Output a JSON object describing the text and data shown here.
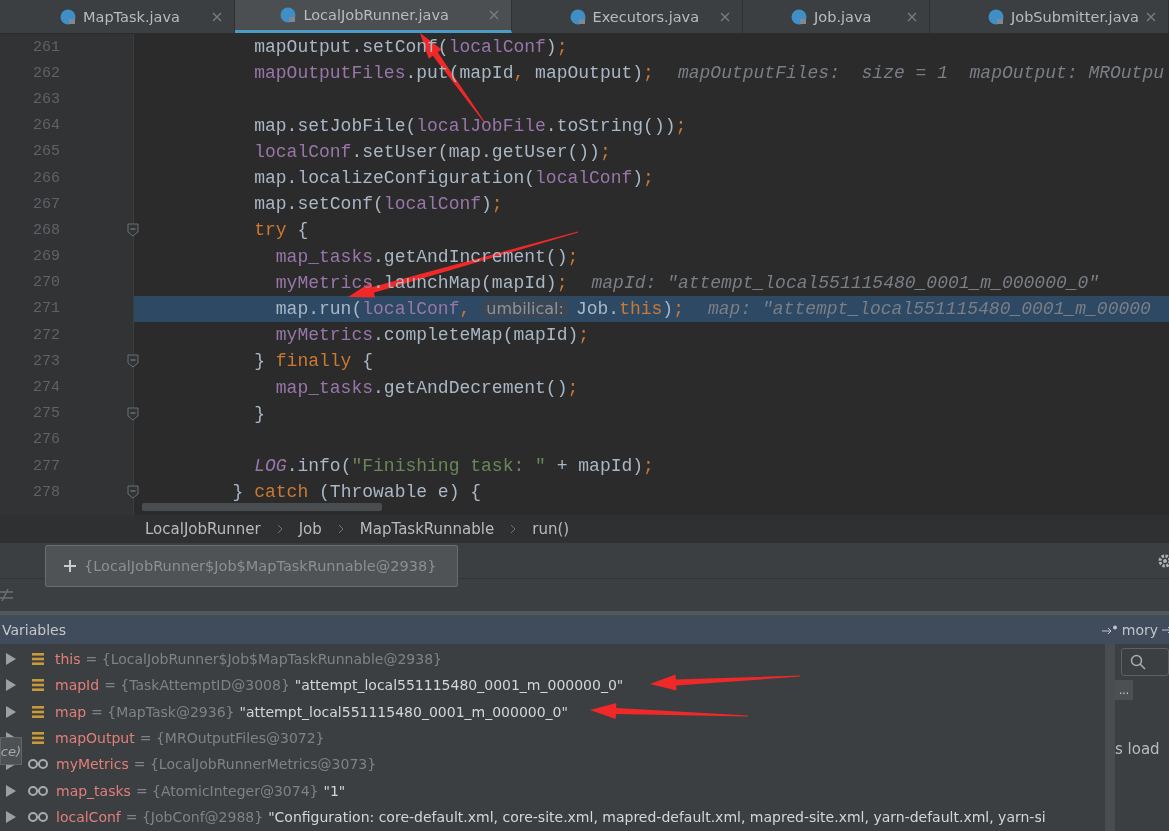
{
  "tabs": [
    {
      "label": "MapTask.java",
      "selected": false
    },
    {
      "label": "LocalJobRunner.java",
      "selected": true
    },
    {
      "label": "Executors.java",
      "selected": false
    },
    {
      "label": "Job.java",
      "selected": false
    },
    {
      "label": "JobSubmitter.java",
      "selected": false
    }
  ],
  "editor": {
    "lines": [
      {
        "number": "261",
        "fold": false,
        "current": false,
        "tokens": [
          {
            "kind": "plain",
            "text": "    mapOutput.setConf("
          },
          {
            "kind": "field",
            "text": "localConf"
          },
          {
            "kind": "plain",
            "text": ")"
          },
          {
            "kind": "keyword",
            "text": ";"
          }
        ]
      },
      {
        "number": "262",
        "fold": false,
        "current": false,
        "tokens": [
          {
            "kind": "field",
            "text": "    mapOutputFiles"
          },
          {
            "kind": "plain",
            "text": ".put(mapId"
          },
          {
            "kind": "keyword",
            "text": ","
          },
          {
            "kind": "plain",
            "text": " mapOutput)"
          },
          {
            "kind": "keyword",
            "text": ";"
          },
          {
            "kind": "hint",
            "text": "mapOutputFiles:  size = 1  mapOutput: MROutpu"
          }
        ]
      },
      {
        "number": "263",
        "fold": false,
        "current": false
      },
      {
        "number": "264",
        "fold": false,
        "current": false,
        "tokens": [
          {
            "kind": "plain",
            "text": "    map.setJobFile("
          },
          {
            "kind": "field",
            "text": "localJobFile"
          },
          {
            "kind": "plain",
            "text": ".toString())"
          },
          {
            "kind": "keyword",
            "text": ";"
          }
        ]
      },
      {
        "number": "265",
        "fold": false,
        "current": false,
        "tokens": [
          {
            "kind": "field",
            "text": "    localConf"
          },
          {
            "kind": "plain",
            "text": ".setUser(map.getUser())"
          },
          {
            "kind": "keyword",
            "text": ";"
          }
        ]
      },
      {
        "number": "266",
        "fold": false,
        "current": false,
        "tokens": [
          {
            "kind": "plain",
            "text": "    map.localizeConfiguration("
          },
          {
            "kind": "field",
            "text": "localConf"
          },
          {
            "kind": "plain",
            "text": ")"
          },
          {
            "kind": "keyword",
            "text": ";"
          }
        ]
      },
      {
        "number": "267",
        "fold": false,
        "current": false,
        "tokens": [
          {
            "kind": "plain",
            "text": "    map.setConf("
          },
          {
            "kind": "field",
            "text": "localConf"
          },
          {
            "kind": "plain",
            "text": ")"
          },
          {
            "kind": "keyword",
            "text": ";"
          }
        ]
      },
      {
        "number": "268",
        "fold": true,
        "current": false,
        "tokens": [
          {
            "kind": "keyword",
            "text": "    try"
          },
          {
            "kind": "plain",
            "text": " {"
          }
        ]
      },
      {
        "number": "269",
        "fold": false,
        "current": false,
        "tokens": [
          {
            "kind": "field",
            "text": "      map_tasks"
          },
          {
            "kind": "plain",
            "text": ".getAndIncrement()"
          },
          {
            "kind": "keyword",
            "text": ";"
          }
        ]
      },
      {
        "number": "270",
        "fold": false,
        "current": false,
        "tokens": [
          {
            "kind": "field",
            "text": "      myMetrics"
          },
          {
            "kind": "plain",
            "text": ".launchMap(mapId)"
          },
          {
            "kind": "keyword",
            "text": ";"
          },
          {
            "kind": "hint",
            "text": "mapId: \"attempt_local551115480_0001_m_000000_0\""
          }
        ]
      },
      {
        "number": "271",
        "fold": false,
        "current": true,
        "tokens": [
          {
            "kind": "plain",
            "text": "      map.run("
          },
          {
            "kind": "field",
            "text": "localConf"
          },
          {
            "kind": "keyword",
            "text": ","
          },
          {
            "kind": "param",
            "text": "umbilical:"
          },
          {
            "kind": "plain",
            "text": "Job."
          },
          {
            "kind": "keyword",
            "text": "this"
          },
          {
            "kind": "plain",
            "text": ")"
          },
          {
            "kind": "keyword",
            "text": ";"
          },
          {
            "kind": "hint",
            "text": "map: \"attempt_local551115480_0001_m_00000"
          }
        ]
      },
      {
        "number": "272",
        "fold": false,
        "current": false,
        "tokens": [
          {
            "kind": "field",
            "text": "      myMetrics"
          },
          {
            "kind": "plain",
            "text": ".completeMap(mapId)"
          },
          {
            "kind": "keyword",
            "text": ";"
          }
        ]
      },
      {
        "number": "273",
        "fold": true,
        "current": false,
        "tokens": [
          {
            "kind": "plain",
            "text": "    } "
          },
          {
            "kind": "keyword",
            "text": "finally"
          },
          {
            "kind": "plain",
            "text": " {"
          }
        ]
      },
      {
        "number": "274",
        "fold": false,
        "current": false,
        "tokens": [
          {
            "kind": "field",
            "text": "      map_tasks"
          },
          {
            "kind": "plain",
            "text": ".getAndDecrement()"
          },
          {
            "kind": "keyword",
            "text": ";"
          }
        ]
      },
      {
        "number": "275",
        "fold": true,
        "current": false,
        "tokens": [
          {
            "kind": "plain",
            "text": "    }"
          }
        ]
      },
      {
        "number": "276",
        "fold": false,
        "current": false
      },
      {
        "number": "277",
        "fold": false,
        "current": false,
        "tokens": [
          {
            "kind": "static",
            "text": "    LOG"
          },
          {
            "kind": "plain",
            "text": ".info("
          },
          {
            "kind": "string",
            "text": "\"Finishing task: \""
          },
          {
            "kind": "plain",
            "text": " + mapId)"
          },
          {
            "kind": "keyword",
            "text": ";"
          }
        ]
      },
      {
        "number": "278",
        "fold": true,
        "current": false,
        "tokens": [
          {
            "kind": "plain",
            "text": "  } "
          },
          {
            "kind": "keyword",
            "text": "catch"
          },
          {
            "kind": "plain",
            "text": " (Throwable e) {"
          }
        ]
      }
    ]
  },
  "breadcrumbs": [
    "LocalJobRunner",
    "Job",
    "MapTaskRunnable",
    "run()"
  ],
  "popup": {
    "text": "{LocalJobRunner$Job$MapTaskRunnable@2938}"
  },
  "variables": {
    "title": "Variables",
    "header_right": "mory",
    "rows": [
      {
        "kind": "field",
        "name": "this",
        "ref": "= {LocalJobRunner$Job$MapTaskRunnable@2938}"
      },
      {
        "kind": "field",
        "name": "mapId",
        "ref": "= {TaskAttemptID@3008}",
        "value": "\"attempt_local551115480_0001_m_000000_0\""
      },
      {
        "kind": "field",
        "name": "map",
        "ref": "= {MapTask@2936}",
        "value": "\"attempt_local551115480_0001_m_000000_0\""
      },
      {
        "kind": "field",
        "name": "mapOutput",
        "ref": "= {MROutputFiles@3072}"
      },
      {
        "kind": "watch",
        "name": "myMetrics",
        "ref": "= {LocalJobRunnerMetrics@3073}"
      },
      {
        "kind": "watch",
        "name": "map_tasks",
        "ref": "= {AtomicInteger@3074}",
        "value": "\"1\""
      },
      {
        "kind": "watch",
        "name": "localConf",
        "ref": "= {JobConf@2988}",
        "value": "\"Configuration: core-default.xml, core-site.xml, mapred-default.xml, mapred-site.xml, yarn-default.xml, yarn-si"
      }
    ]
  },
  "side_panel": {
    "button": "...",
    "text": "s load"
  },
  "tooltip_fragment": "ce)"
}
